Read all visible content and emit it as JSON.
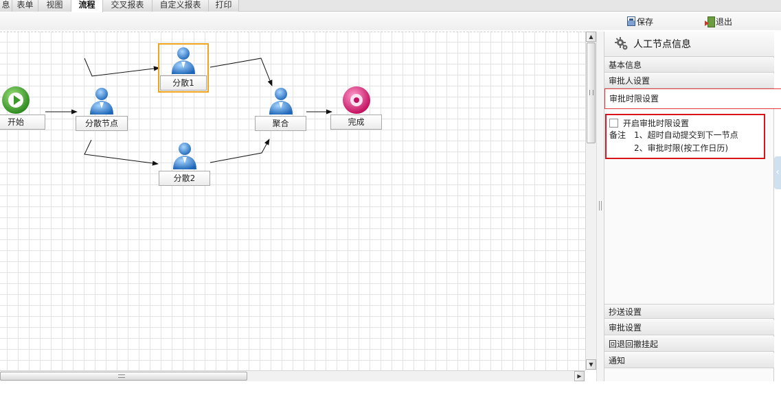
{
  "tabs": [
    {
      "label": "息",
      "active": false
    },
    {
      "label": "表单",
      "active": false
    },
    {
      "label": "视图",
      "active": false
    },
    {
      "label": "流程",
      "active": true
    },
    {
      "label": "交叉报表",
      "active": false
    },
    {
      "label": "自定义报表",
      "active": false
    },
    {
      "label": "打印",
      "active": false
    }
  ],
  "toolbar": {
    "save_label": "保存",
    "exit_label": "退出"
  },
  "flow": {
    "start_label": "开始",
    "split_label": "分散节点",
    "branch1_label": "分散1",
    "branch2_label": "分散2",
    "join_label": "聚合",
    "end_label": "完成"
  },
  "panel": {
    "title": "人工节点信息",
    "sections_top": [
      "基本信息",
      "审批人设置",
      "审批时限设置"
    ],
    "timelimit": {
      "checkbox_label": "开启审批时限设置",
      "checked": false,
      "note_label": "备注",
      "note_line1": "1、超时自动提交到下一节点",
      "note_line2": "2、审批时限(按工作日历)"
    },
    "sections_bottom": [
      "抄送设置",
      "审批设置",
      "回退回撤挂起",
      "通知"
    ]
  },
  "colors": {
    "accent_selected": "#f0a21a",
    "highlight_red": "#d8141a",
    "start_green": "#4aa336",
    "end_pink": "#d8227a",
    "person_blue": "#2f7fcf"
  }
}
